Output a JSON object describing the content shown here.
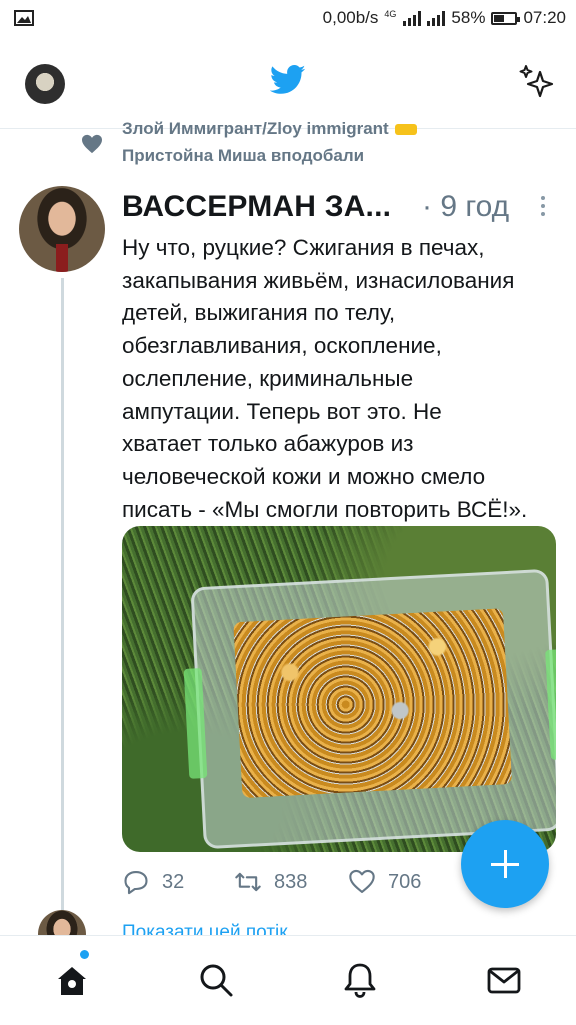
{
  "status_bar": {
    "network_speed": "0,00b/s",
    "network_type": "4G",
    "battery_percent": "58%",
    "battery_level": 0.58,
    "time": "07:20",
    "left_icon": "image-icon"
  },
  "header": {
    "profile_icon": "profile-avatar",
    "logo_icon": "twitter-bird-icon",
    "action_icon": "sparkle-icon"
  },
  "social_context": {
    "icon": "heart-icon",
    "line1": "Злой Иммигрант/Zloy immigrant",
    "line2": "Пристойна Миша вподобали"
  },
  "tweet": {
    "author": "ВАССЕРМАН ЗА...",
    "time": "· 9 год",
    "text_lines": [
      "Ну что, руцкие? Сжигания в печах,",
      "закапывания живьём, изнасилования",
      "детей, выжигания по телу,",
      "обезглавливания, оскопление,",
      "ослепление, криминальные",
      "ампутации. Теперь вот это. Не",
      "хватает только абажуров из",
      "человеческой кожи и можно смело",
      "писать - «Мы смогли повторить ВСЁ!»."
    ],
    "media_icon": "photo-gold-crowns",
    "replies": "32",
    "retweets": "838",
    "likes": "706"
  },
  "show_thread": "Показати цей потік",
  "compose_icon": "plus-icon",
  "nav": {
    "items": [
      "home-icon",
      "search-icon",
      "notifications-icon",
      "messages-icon"
    ],
    "accent": "#1da1f2"
  }
}
